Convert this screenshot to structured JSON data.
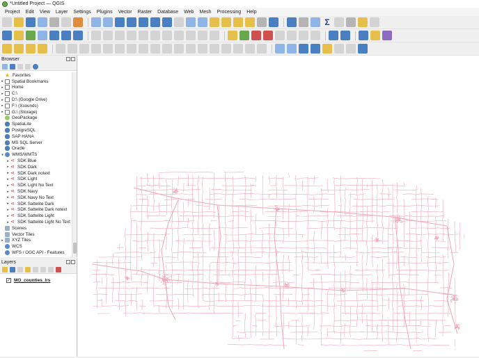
{
  "window": {
    "title": "*Untitled Project — QGIS"
  },
  "menu": [
    "Project",
    "Edit",
    "View",
    "Layer",
    "Settings",
    "Plugins",
    "Vector",
    "Raster",
    "Database",
    "Web",
    "Mesh",
    "Processing",
    "Help"
  ],
  "browser": {
    "title": "Browser",
    "items": [
      {
        "label": "Favorites",
        "icon": "star-icon",
        "expand": false
      },
      {
        "label": "Spatial Bookmarks",
        "icon": "bookmark-folder-icon",
        "expand": true
      },
      {
        "label": "Home",
        "icon": "home-folder-icon",
        "expand": true
      },
      {
        "label": "C:\\",
        "icon": "drive-icon",
        "expand": true
      },
      {
        "label": "D:\\ (Google Drive)",
        "icon": "drive-icon",
        "expand": true
      },
      {
        "label": "F:\\ (Xsounds)",
        "icon": "drive-icon",
        "expand": true
      },
      {
        "label": "G:\\ (Storage)",
        "icon": "drive-icon",
        "expand": true
      },
      {
        "label": "GeoPackage",
        "icon": "geopackage-icon",
        "expand": false
      },
      {
        "label": "SpatiaLite",
        "icon": "spatialite-icon",
        "expand": false
      },
      {
        "label": "PostgreSQL",
        "icon": "postgresql-icon",
        "expand": false
      },
      {
        "label": "SAP HANA",
        "icon": "sap-hana-icon",
        "expand": false
      },
      {
        "label": "MS SQL Server",
        "icon": "mssql-icon",
        "expand": false
      },
      {
        "label": "Oracle",
        "icon": "oracle-icon",
        "expand": false
      },
      {
        "label": "WMS/WMTS",
        "icon": "wms-icon",
        "expand": true,
        "open": true
      },
      {
        "label": "SDK Blue",
        "icon": "xyz-tile-icon",
        "indent": 1,
        "expand": true
      },
      {
        "label": "SDK Dark",
        "icon": "xyz-tile-icon",
        "indent": 1,
        "expand": true
      },
      {
        "label": "SDK Dark notext",
        "icon": "xyz-tile-icon",
        "indent": 1,
        "expand": true
      },
      {
        "label": "SDK Light",
        "icon": "xyz-tile-icon",
        "indent": 1,
        "expand": true
      },
      {
        "label": "SDK Light No Text",
        "icon": "xyz-tile-icon",
        "indent": 1,
        "expand": true
      },
      {
        "label": "SDK Navy",
        "icon": "xyz-tile-icon",
        "indent": 1,
        "expand": true
      },
      {
        "label": "SDK Navy No Text",
        "icon": "xyz-tile-icon",
        "indent": 1,
        "expand": true
      },
      {
        "label": "SDK Sattelite Dark",
        "icon": "xyz-tile-icon",
        "indent": 1,
        "expand": true
      },
      {
        "label": "SDK Sattelite Dark notext",
        "icon": "xyz-tile-icon",
        "indent": 1,
        "expand": true
      },
      {
        "label": "SDK Sattelite Light",
        "icon": "xyz-tile-icon",
        "indent": 1,
        "expand": true
      },
      {
        "label": "SDK Sattelite Light No Text",
        "icon": "xyz-tile-icon",
        "indent": 1,
        "expand": true
      },
      {
        "label": "Scenes",
        "icon": "scenes-icon",
        "expand": false
      },
      {
        "label": "Vector Tiles",
        "icon": "vector-tiles-icon",
        "expand": false
      },
      {
        "label": "XYZ Tiles",
        "icon": "xyz-tiles-icon",
        "expand": true
      },
      {
        "label": "WCS",
        "icon": "wcs-icon",
        "expand": false
      },
      {
        "label": "WFS / OGC API - Features",
        "icon": "wfs-icon",
        "expand": false
      }
    ]
  },
  "layers": {
    "title": "Layers",
    "items": [
      {
        "label": "MO_counties_lrs",
        "checked": true,
        "check_mark": "✓"
      }
    ]
  },
  "map": {
    "road_color": "#f0a6b6",
    "background": "#ffffff"
  }
}
